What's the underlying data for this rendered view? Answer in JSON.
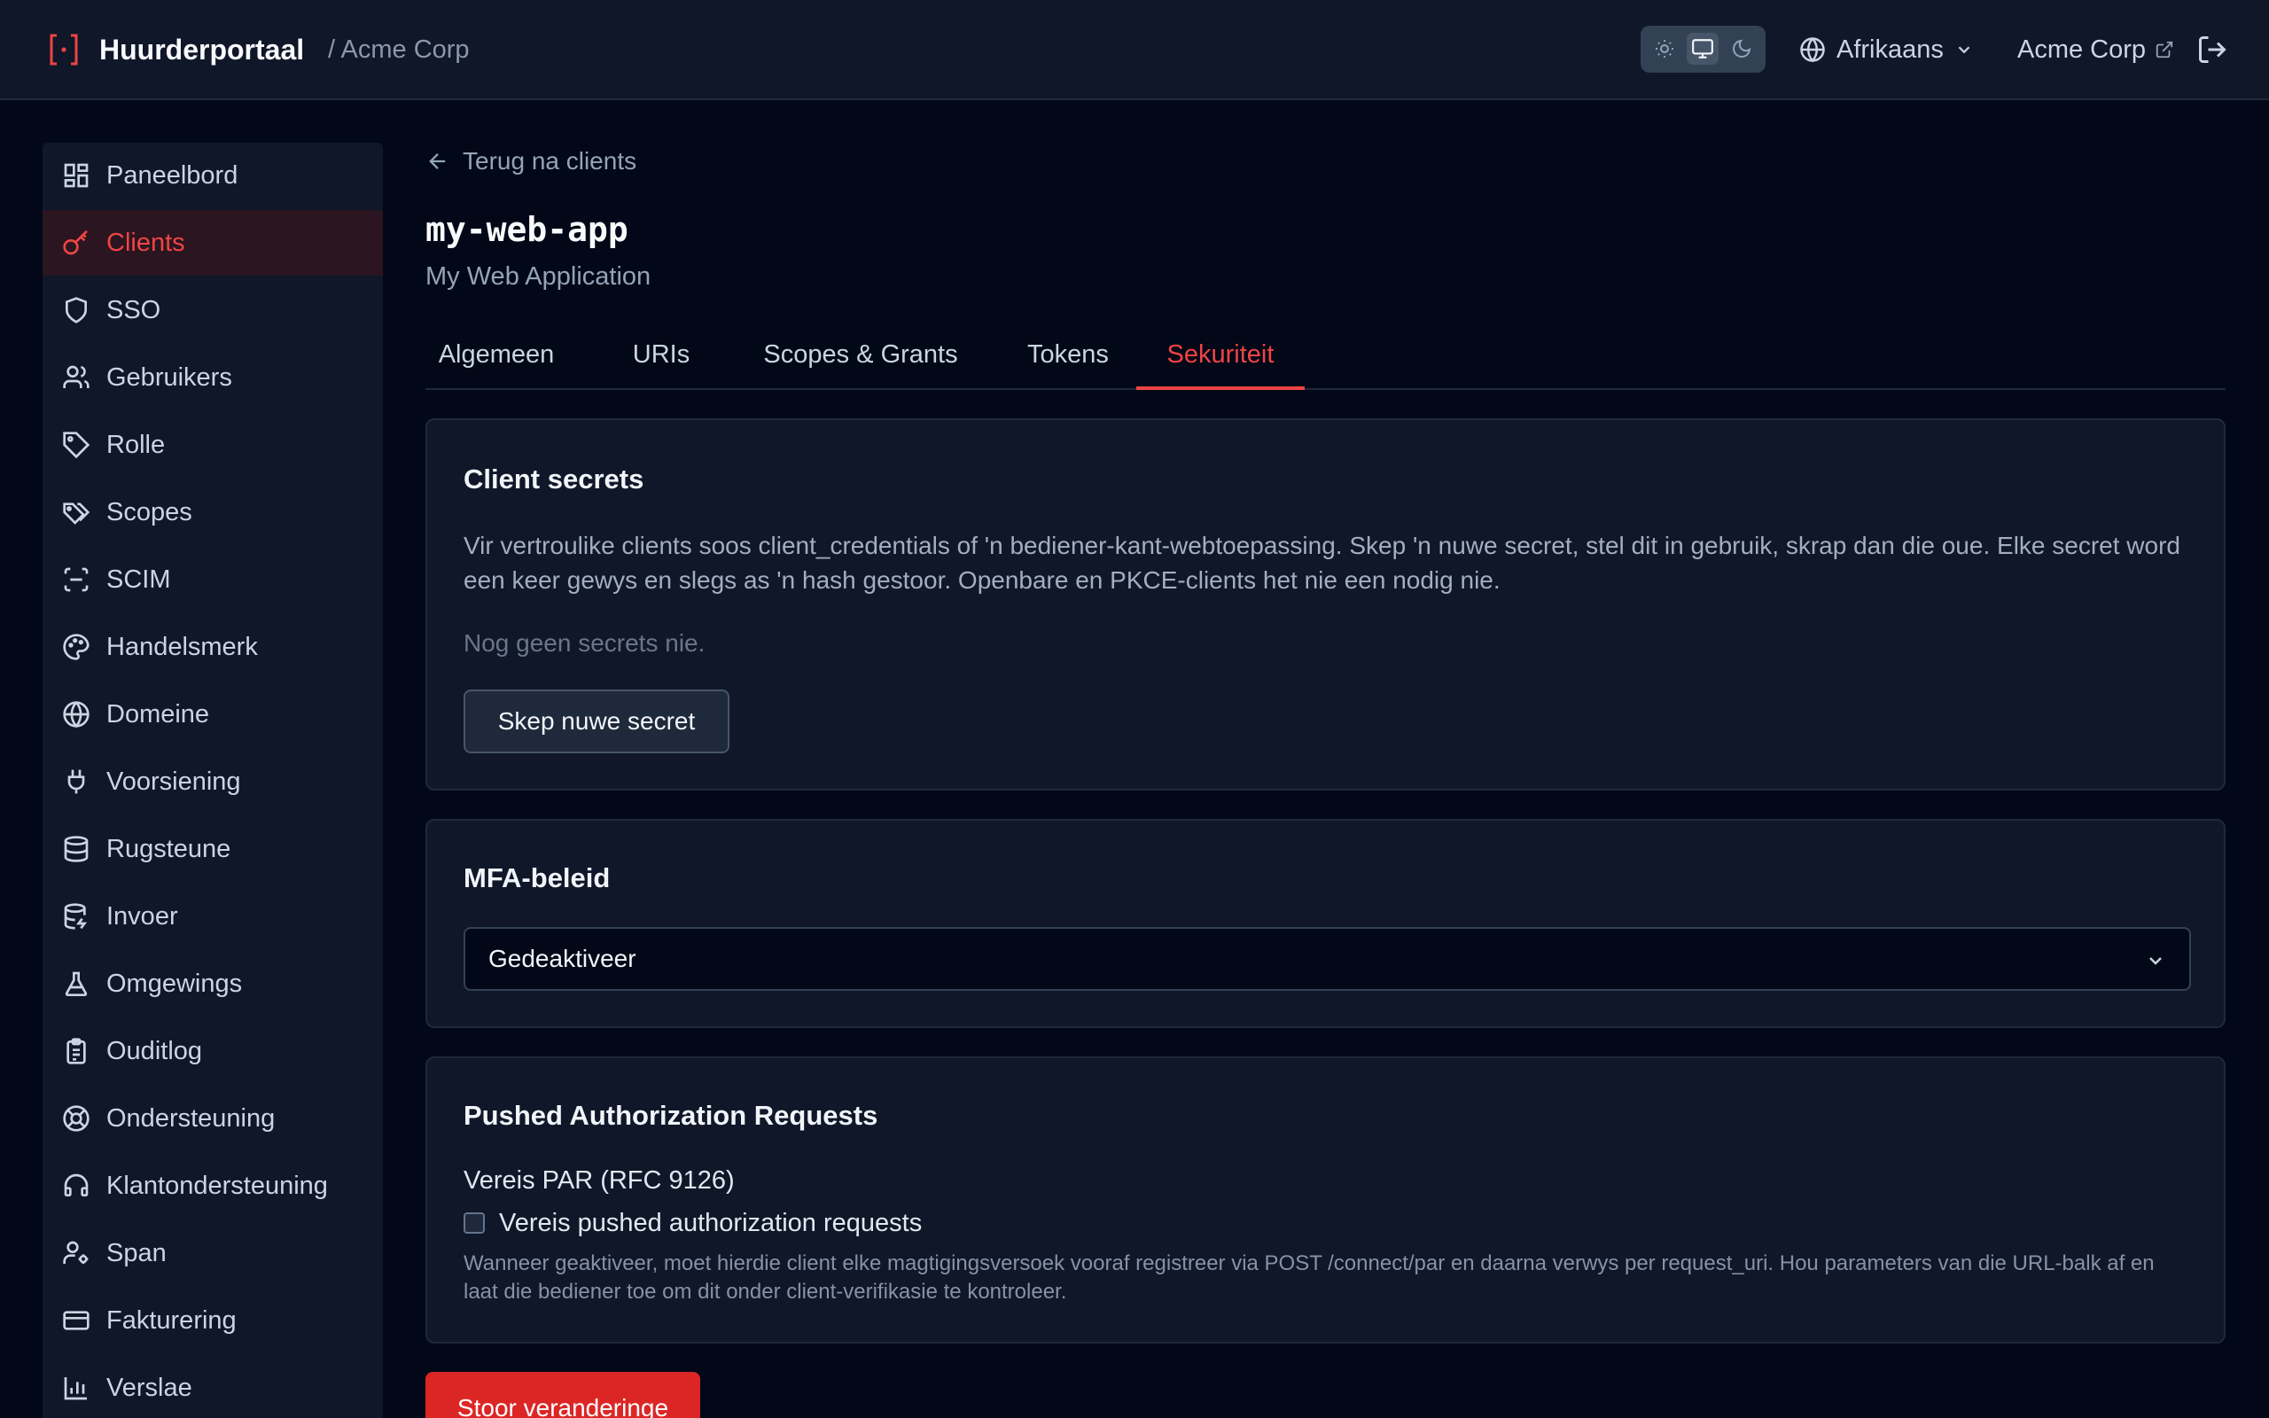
{
  "header": {
    "brand": "Huurderportaal",
    "crumb": "/ Acme Corp",
    "language": "Afrikaans",
    "tenant": "Acme Corp",
    "theme_options": [
      "light",
      "system",
      "dark"
    ],
    "theme_selected": "system"
  },
  "sidebar": {
    "items": [
      {
        "label": "Paneelbord",
        "icon": "dashboard-icon"
      },
      {
        "label": "Clients",
        "icon": "key-icon"
      },
      {
        "label": "SSO",
        "icon": "shield-icon"
      },
      {
        "label": "Gebruikers",
        "icon": "users-icon"
      },
      {
        "label": "Rolle",
        "icon": "tag-icon"
      },
      {
        "label": "Scopes",
        "icon": "tags-icon"
      },
      {
        "label": "SCIM",
        "icon": "scan-icon"
      },
      {
        "label": "Handelsmerk",
        "icon": "palette-icon"
      },
      {
        "label": "Domeine",
        "icon": "globe-icon"
      },
      {
        "label": "Voorsiening",
        "icon": "plug-icon"
      },
      {
        "label": "Rugsteune",
        "icon": "database-icon"
      },
      {
        "label": "Invoer",
        "icon": "database-import-icon"
      },
      {
        "label": "Omgewings",
        "icon": "flask-icon"
      },
      {
        "label": "Ouditlog",
        "icon": "clipboard-icon"
      },
      {
        "label": "Ondersteuning",
        "icon": "lifebuoy-icon"
      },
      {
        "label": "Klantondersteuning",
        "icon": "headset-icon"
      },
      {
        "label": "Span",
        "icon": "user-cog-icon"
      },
      {
        "label": "Fakturering",
        "icon": "credit-card-icon"
      },
      {
        "label": "Verslae",
        "icon": "bar-chart-icon"
      }
    ],
    "active": "Clients"
  },
  "main": {
    "back_label": "Terug na clients",
    "title": "my-web-app",
    "subtitle": "My Web Application",
    "tabs": [
      "Algemeen",
      "URIs",
      "Scopes & Grants",
      "Tokens",
      "Sekuriteit"
    ],
    "active_tab": "Sekuriteit",
    "secrets": {
      "title": "Client secrets",
      "description": "Vir vertroulike clients soos client_credentials of 'n bediener-kant-webtoepassing. Skep 'n nuwe secret, stel dit in gebruik, skrap dan die oue. Elke secret word een keer gewys en slegs as 'n hash gestoor. Openbare en PKCE-clients het nie een nodig nie.",
      "empty": "Nog geen secrets nie.",
      "create_label": "Skep nuwe secret"
    },
    "mfa": {
      "title": "MFA-beleid",
      "value": "Gedeaktiveer"
    },
    "par": {
      "title": "Pushed Authorization Requests",
      "label": "Vereis PAR (RFC 9126)",
      "checkbox_label": "Vereis pushed authorization requests",
      "checked": false,
      "hint": "Wanneer geaktiveer, moet hierdie client elke magtigingsversoek vooraf registreer via POST /connect/par en daarna verwys per request_uri. Hou parameters van die URL-balk af en laat die bediener toe om dit onder client-verifikasie te kontroleer."
    },
    "save_label": "Stoor veranderinge"
  },
  "colors": {
    "accent": "#ef4444",
    "primary_button": "#dc2626",
    "background": "#020817",
    "surface": "#0f1729"
  }
}
